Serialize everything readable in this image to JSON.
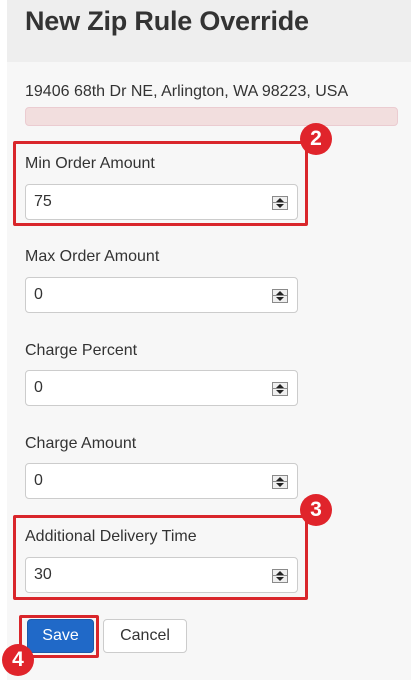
{
  "form": {
    "title": "New Zip Rule Override",
    "address": "19406 68th Dr NE, Arlington, WA 98223, USA",
    "fields": [
      {
        "label": "Min Order Amount",
        "value": "75"
      },
      {
        "label": "Max Order Amount",
        "value": "0"
      },
      {
        "label": "Charge Percent",
        "value": "0"
      },
      {
        "label": "Charge Amount",
        "value": "0"
      },
      {
        "label": "Additional Delivery Time",
        "value": "30"
      }
    ],
    "buttons": {
      "save_label": "Save",
      "cancel_label": "Cancel"
    }
  },
  "annotations": {
    "step_2": "2",
    "step_3": "3",
    "step_4": "4"
  },
  "colors": {
    "highlight": "#d9262b",
    "badge": "#e0242b",
    "primary_button": "#2069c8",
    "alert_bg": "#f2dede"
  }
}
